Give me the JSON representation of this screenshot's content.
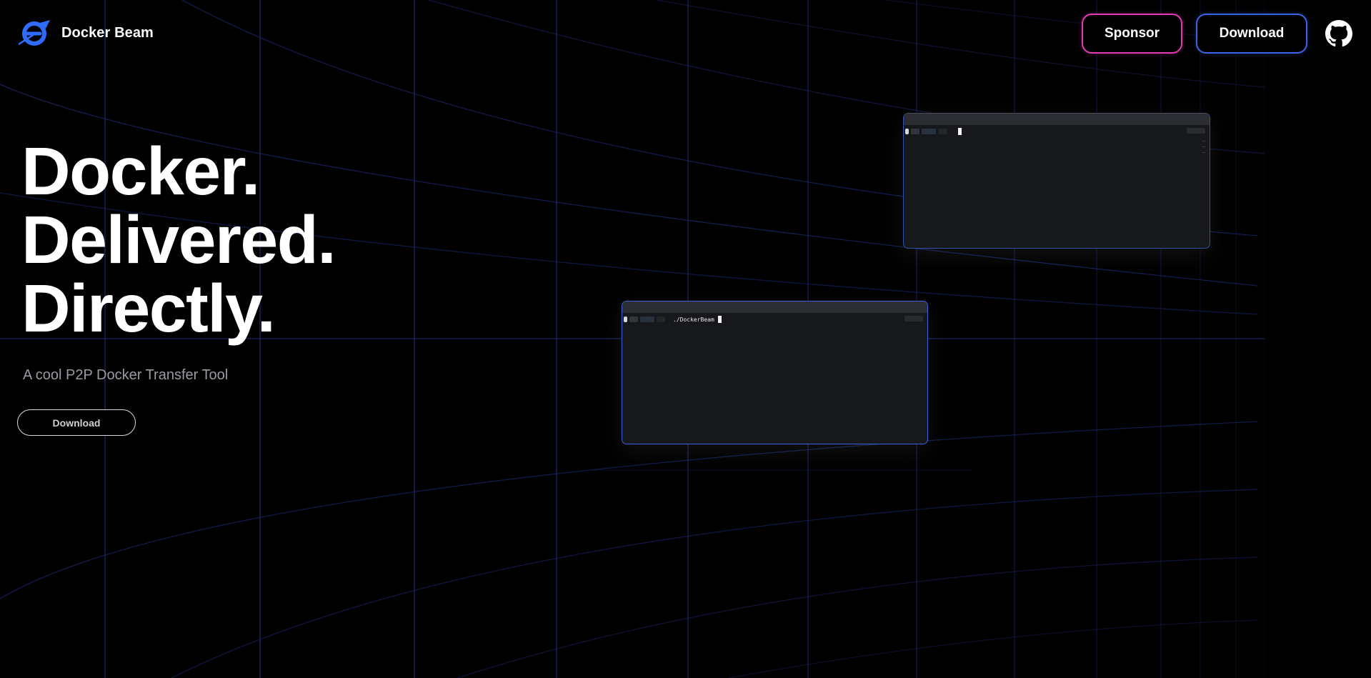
{
  "header": {
    "brand_name": "Docker Beam",
    "logo_icon": "docker-beam-logo-icon",
    "sponsor_label": "Sponsor",
    "download_label": "Download",
    "github_icon": "github-icon"
  },
  "hero": {
    "title_lines": [
      "Docker.",
      "Delivered.",
      "Directly."
    ],
    "subtitle": "A cool P2P Docker Transfer Tool",
    "download_label": "Download"
  },
  "terminals": {
    "top": {
      "command": ""
    },
    "bottom": {
      "command": "./DockerBeam"
    }
  },
  "colors": {
    "background": "#000000",
    "sponsor_border": "#e23bb5",
    "download_border": "#3b63e6",
    "accent_blue": "#2f6bff",
    "grid_line": "#1e2a66",
    "subtitle": "#9a9aa2",
    "terminal_bg": "#17181c"
  }
}
